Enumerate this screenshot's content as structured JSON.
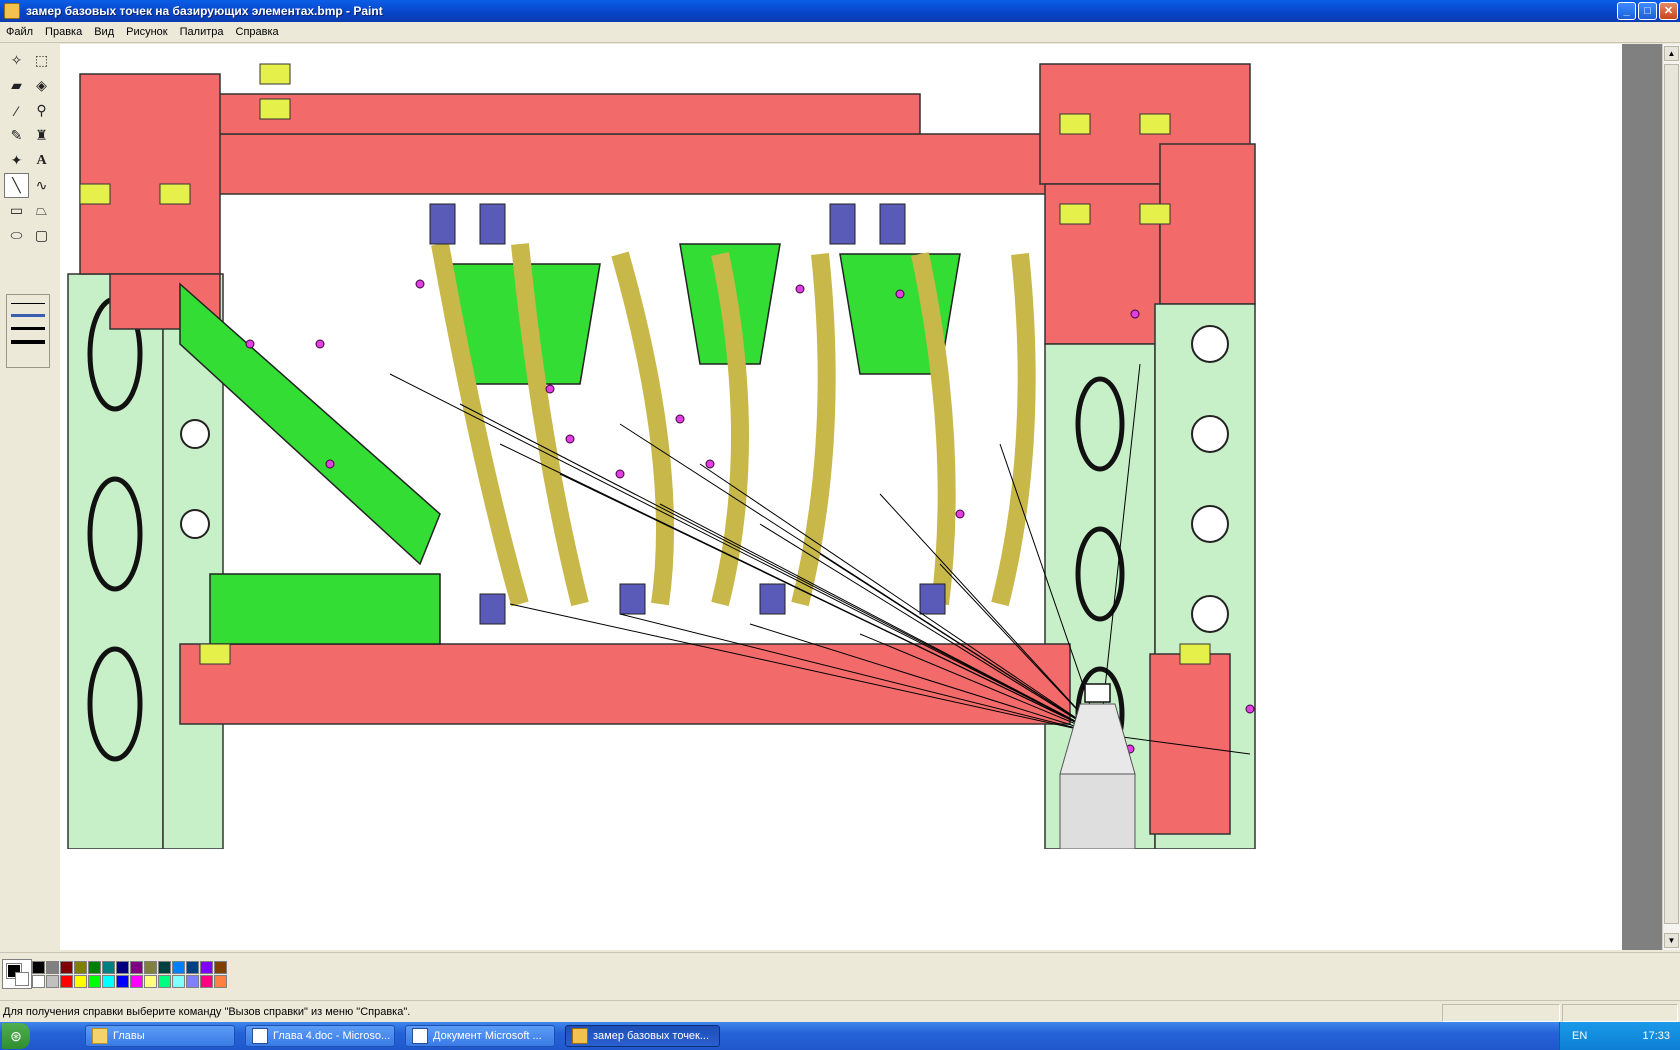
{
  "window": {
    "title": "замер базовых точек на базирующих элементах.bmp - Paint",
    "controls": {
      "minimize": "_",
      "maximize": "□",
      "close": "✕"
    }
  },
  "menu": [
    "Файл",
    "Правка",
    "Вид",
    "Рисунок",
    "Палитра",
    "Справка"
  ],
  "tools": [
    {
      "name": "free-select-tool",
      "glyph": "✧"
    },
    {
      "name": "rect-select-tool",
      "glyph": "⬚"
    },
    {
      "name": "eraser-tool",
      "glyph": "▰"
    },
    {
      "name": "fill-tool",
      "glyph": "◈"
    },
    {
      "name": "color-picker-tool",
      "glyph": "⁄"
    },
    {
      "name": "magnifier-tool",
      "glyph": "⚲"
    },
    {
      "name": "pencil-tool",
      "glyph": "✎"
    },
    {
      "name": "brush-tool",
      "glyph": "♜"
    },
    {
      "name": "airbrush-tool",
      "glyph": "✦"
    },
    {
      "name": "text-tool",
      "glyph": "A"
    },
    {
      "name": "line-tool",
      "glyph": "╲"
    },
    {
      "name": "curve-tool",
      "glyph": "∿"
    },
    {
      "name": "rectangle-tool",
      "glyph": "▭"
    },
    {
      "name": "polygon-tool",
      "glyph": "⏢"
    },
    {
      "name": "ellipse-tool",
      "glyph": "⬭"
    },
    {
      "name": "rounded-rect-tool",
      "glyph": "▢"
    }
  ],
  "colors": {
    "frame_red": "#f26a6a",
    "frame_red_dark": "#c84040",
    "pale_green": "#c8f0c8",
    "bright_green": "#33dd33",
    "olive": "#c8b84a",
    "yellow": "#f2f24a",
    "navy": "#5a5ab8",
    "magenta": "#e040e0",
    "gray_bg": "#808080",
    "title_blue": "#0a5ee6"
  },
  "palette": {
    "row1": [
      "#000000",
      "#808080",
      "#800000",
      "#808000",
      "#008000",
      "#008080",
      "#000080",
      "#800080",
      "#808040",
      "#004040",
      "#0080ff",
      "#004080",
      "#8000ff",
      "#804000"
    ],
    "row2": [
      "#ffffff",
      "#c0c0c0",
      "#ff0000",
      "#ffff00",
      "#00ff00",
      "#00ffff",
      "#0000ff",
      "#ff00ff",
      "#ffff80",
      "#00ff80",
      "#80ffff",
      "#8080ff",
      "#ff0080",
      "#ff8040"
    ]
  },
  "status": {
    "text": "Для получения справки выберите команду \"Вызов справки\" из меню \"Справка\"."
  },
  "taskbar": {
    "items": [
      {
        "label": "Главы",
        "icon": "folder-icon"
      },
      {
        "label": "Глава 4.doc - Microso...",
        "icon": "word-icon"
      },
      {
        "label": "Документ Microsoft ...",
        "icon": "word-icon"
      },
      {
        "label": "замер базовых точек...",
        "icon": "paint-icon",
        "active": true
      }
    ],
    "lang": "EN",
    "clock": "17:33"
  }
}
